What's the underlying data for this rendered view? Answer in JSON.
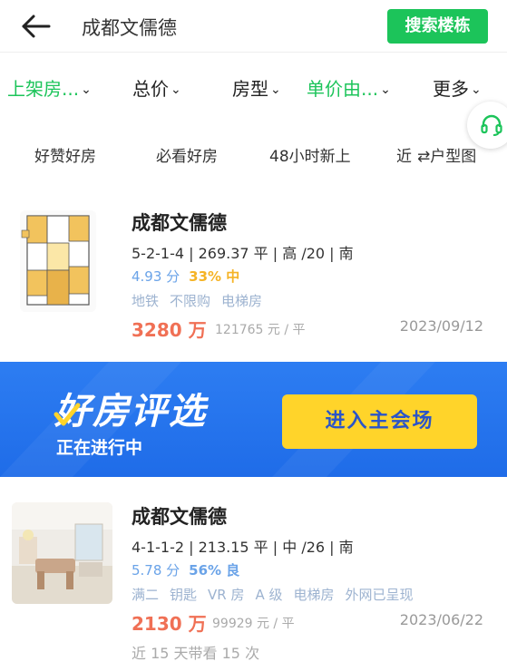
{
  "header": {
    "title": "成都文儒德",
    "search_button": "搜索楼栋"
  },
  "filters": [
    {
      "label": "上架房...",
      "active": true
    },
    {
      "label": "总价",
      "active": false
    },
    {
      "label": "房型",
      "active": false
    },
    {
      "label": "单价由...",
      "active": true
    },
    {
      "label": "更多",
      "active": false
    }
  ],
  "chips": [
    "好赞好房",
    "必看好房",
    "48小时新上",
    "近",
    "⇄户型图"
  ],
  "listings": [
    {
      "name": "成都文儒德",
      "spec": "5-2-1-4 | 269.37 平 | 高 /20 | 南",
      "score": "4.93 分",
      "percent": "33% 中",
      "tags": [
        "地铁",
        "不限购",
        "电梯房"
      ],
      "price": "3280 万",
      "unit_price": "121765 元 / 平",
      "date": "2023/09/12"
    },
    {
      "name": "成都文儒德",
      "spec": "4-1-1-2 | 213.15 平 | 中 /26 | 南",
      "score": "5.78 分",
      "percent": "56% 良",
      "tags": [
        "满二",
        "钥匙",
        "VR 房",
        "A 级",
        "电梯房",
        "外网已呈现"
      ],
      "price": "2130 万",
      "unit_price": "99929 元 / 平",
      "date": "2023/06/22",
      "extra": "近 15 天带看 15 次"
    }
  ],
  "banner": {
    "title": "好房评选",
    "subtitle": "正在进行中",
    "button": "进入主会场"
  },
  "colors": {
    "accent": "#1cc45a",
    "price": "#f07055",
    "score": "#6aa3e8",
    "percent_mid": "#f5b325",
    "percent_good": "#6aa3e8",
    "banner": "#2d7df2",
    "banner_button": "#ffd42a"
  }
}
